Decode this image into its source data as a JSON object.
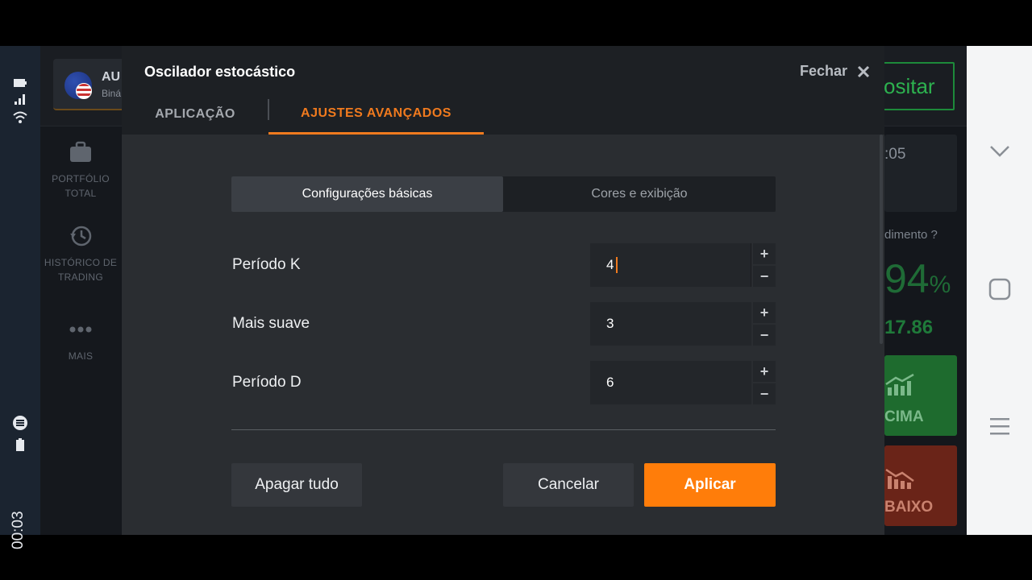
{
  "status_bar": {
    "time": "00:03"
  },
  "app": {
    "asset": {
      "name": "AU",
      "type": "Biná"
    },
    "deposit_label": "ositar",
    "side_menu": [
      {
        "label": "PORTFÓLIO TOTAL",
        "icon": "briefcase-icon"
      },
      {
        "label": "HISTÓRICO DE TRADING",
        "icon": "history-icon"
      },
      {
        "label": "MAIS",
        "icon": "more-dots-icon"
      }
    ],
    "timer": ":05",
    "yield_label": "dimento",
    "yield_value": "94",
    "yield_unit": "%",
    "yield_amount": "17.86",
    "up_label": "CIMA",
    "down_label": "BAIXO"
  },
  "modal": {
    "title": "Oscilador estocástico",
    "close_label": "Fechar",
    "tabs": [
      {
        "label": "APLICAÇÃO",
        "active": false
      },
      {
        "label": "AJUSTES AVANÇADOS",
        "active": true
      }
    ],
    "segments": [
      {
        "label": "Configurações básicas",
        "active": true
      },
      {
        "label": "Cores e exibição",
        "active": false
      }
    ],
    "fields": [
      {
        "label": "Período K",
        "value": "4"
      },
      {
        "label": "Mais suave",
        "value": "3"
      },
      {
        "label": "Período D",
        "value": "6"
      }
    ],
    "stepper": {
      "plus": "+",
      "minus": "−"
    },
    "buttons": {
      "clear": "Apagar tudo",
      "cancel": "Cancelar",
      "apply": "Aplicar"
    }
  },
  "colors": {
    "accent": "#ff7d0a",
    "tab_active": "#f07a1e",
    "up": "#1e6b2e",
    "down": "#6a2418"
  }
}
